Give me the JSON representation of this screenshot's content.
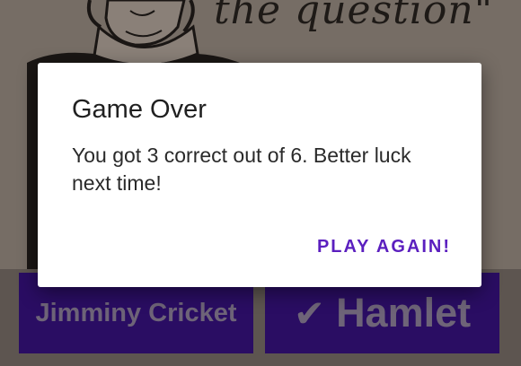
{
  "background": {
    "quote_text": "the question\"",
    "answers": [
      {
        "label": "Jimminy Cricket",
        "correct": false
      },
      {
        "label": "Hamlet",
        "correct": true,
        "icon": "checkmark-icon"
      }
    ],
    "answer_button_color": "#2a0d63",
    "check_glyph": "✔"
  },
  "dialog": {
    "title": "Game Over",
    "message": "You got 3 correct out of 6. Better luck next time!",
    "action_label": "PLAY AGAIN!",
    "action_color": "#5b1fbf"
  }
}
